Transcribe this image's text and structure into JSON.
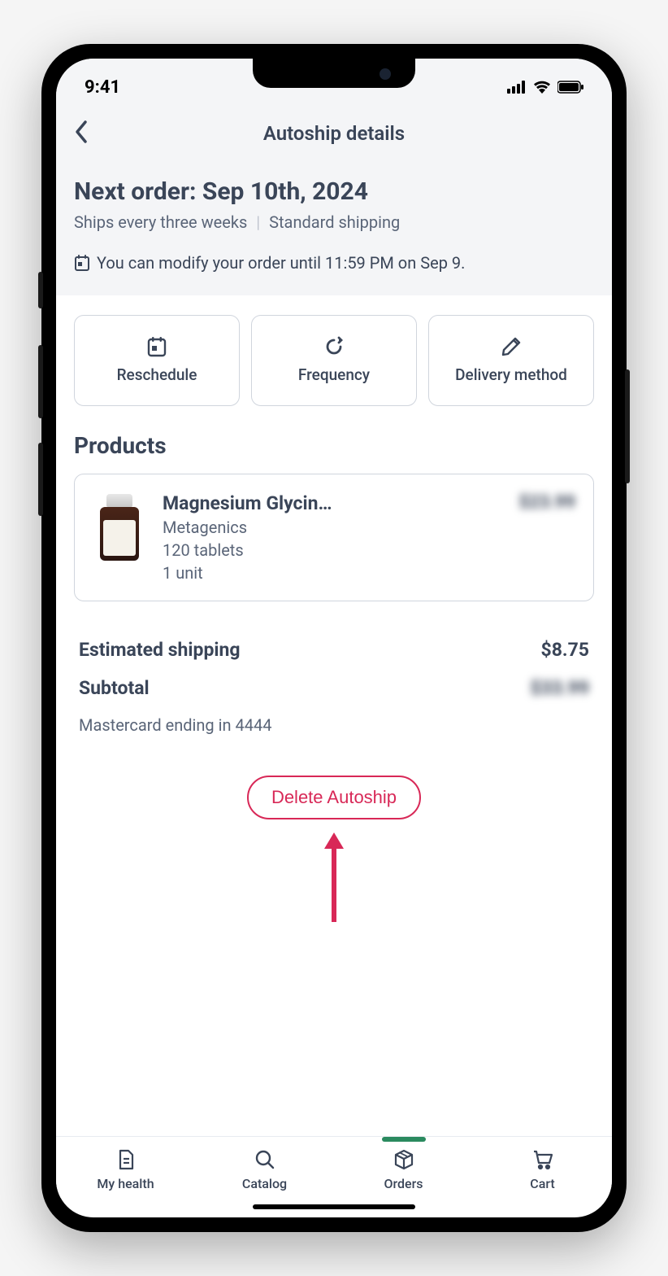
{
  "statusBar": {
    "time": "9:41"
  },
  "header": {
    "title": "Autoship details"
  },
  "info": {
    "nextOrderLabel": "Next order: Sep 10th, 2024",
    "shipFrequency": "Ships every three weeks",
    "shipMethod": "Standard shipping",
    "modifyNote": "You can modify your order until 11:59 PM on Sep 9."
  },
  "actions": {
    "reschedule": "Reschedule",
    "frequency": "Frequency",
    "delivery": "Delivery method"
  },
  "products": {
    "title": "Products",
    "items": [
      {
        "name": "Magnesium Glycin…",
        "brand": "Metagenics",
        "qty": "120 tablets",
        "units": "1 unit",
        "price": "$23.99"
      }
    ]
  },
  "summary": {
    "shippingLabel": "Estimated shipping",
    "shippingValue": "$8.75",
    "subtotalLabel": "Subtotal",
    "subtotalValue": "$33.99",
    "payment": "Mastercard ending in 4444"
  },
  "deleteBtn": "Delete Autoship",
  "nav": {
    "myHealth": "My health",
    "catalog": "Catalog",
    "orders": "Orders",
    "cart": "Cart"
  }
}
